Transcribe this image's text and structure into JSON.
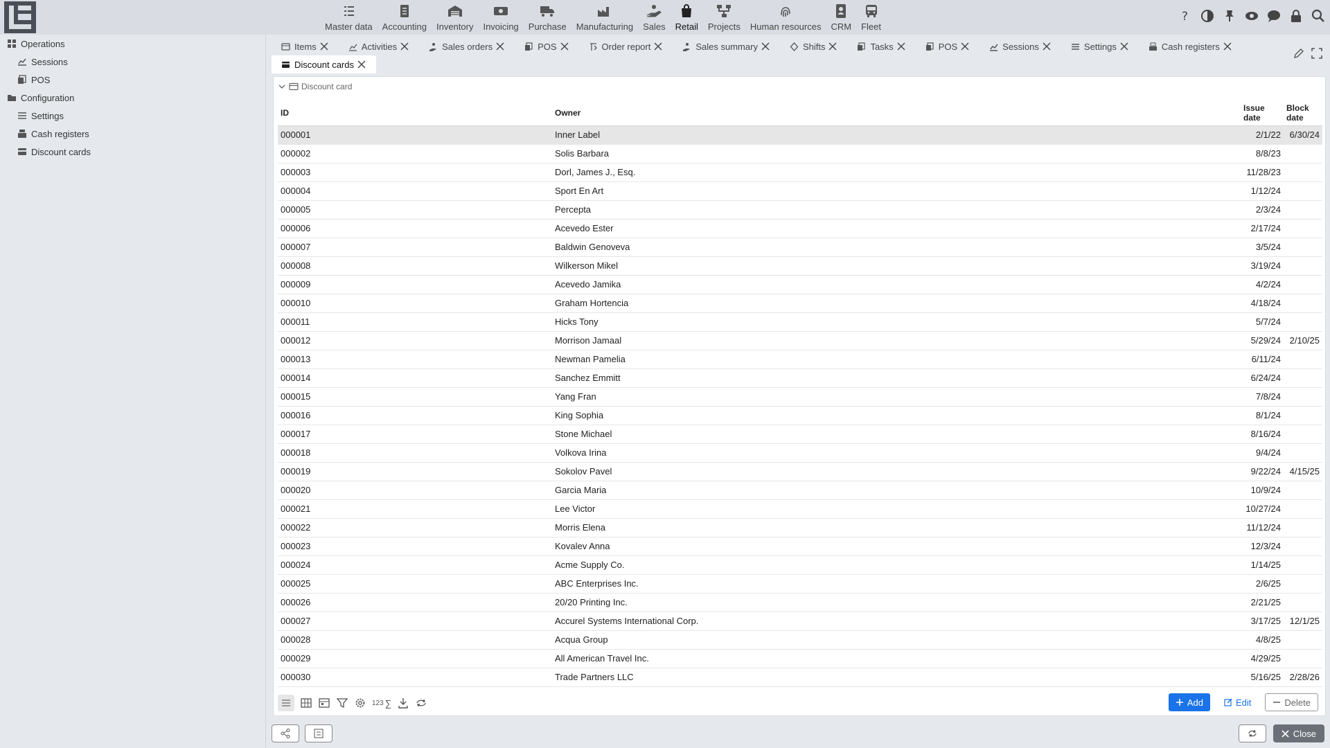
{
  "nav": [
    {
      "label": "Master data",
      "icon": "list-icon"
    },
    {
      "label": "Accounting",
      "icon": "document-icon"
    },
    {
      "label": "Inventory",
      "icon": "warehouse-icon"
    },
    {
      "label": "Invoicing",
      "icon": "cash-icon"
    },
    {
      "label": "Purchase",
      "icon": "truck-icon"
    },
    {
      "label": "Manufacturing",
      "icon": "factory-icon"
    },
    {
      "label": "Sales",
      "icon": "sales-hand-icon"
    },
    {
      "label": "Retail",
      "icon": "shopping-bag-icon",
      "active": true
    },
    {
      "label": "Projects",
      "icon": "project-tree-icon"
    },
    {
      "label": "Human resources",
      "icon": "fingerprint-icon"
    },
    {
      "label": "CRM",
      "icon": "contact-card-icon"
    },
    {
      "label": "Fleet",
      "icon": "bus-icon"
    }
  ],
  "top_icons": [
    "help-icon",
    "contrast-icon",
    "pin-icon",
    "eye-icon",
    "chat-icon",
    "lock-icon",
    "search-icon"
  ],
  "sidebar": {
    "groups": [
      {
        "label": "Operations",
        "items": [
          {
            "label": "Sessions"
          },
          {
            "label": "POS"
          }
        ]
      },
      {
        "label": "Configuration",
        "items": [
          {
            "label": "Settings"
          },
          {
            "label": "Cash registers"
          },
          {
            "label": "Discount cards"
          }
        ]
      }
    ]
  },
  "tabs": [
    {
      "label": "Items"
    },
    {
      "label": "Activities"
    },
    {
      "label": "Sales orders"
    },
    {
      "label": "POS"
    },
    {
      "label": "Order report"
    },
    {
      "label": "Sales summary"
    },
    {
      "label": "Shifts"
    },
    {
      "label": "Tasks"
    },
    {
      "label": "POS"
    },
    {
      "label": "Sessions"
    },
    {
      "label": "Settings"
    },
    {
      "label": "Cash registers"
    },
    {
      "label": "Discount cards",
      "active": true
    }
  ],
  "panel": {
    "title": "Discount card",
    "columns": {
      "id": "ID",
      "owner": "Owner",
      "issue_line1": "Issue",
      "issue_line2": "date",
      "block_line1": "Block",
      "block_line2": "date"
    },
    "rows": [
      {
        "id": "000001",
        "owner": "Inner Label",
        "issue": "2/1/22",
        "block": "6/30/24"
      },
      {
        "id": "000002",
        "owner": "Solis Barbara",
        "issue": "8/8/23",
        "block": ""
      },
      {
        "id": "000003",
        "owner": "Dorl, James J., Esq.",
        "issue": "11/28/23",
        "block": ""
      },
      {
        "id": "000004",
        "owner": "Sport En Art",
        "issue": "1/12/24",
        "block": ""
      },
      {
        "id": "000005",
        "owner": "Percepta",
        "issue": "2/3/24",
        "block": ""
      },
      {
        "id": "000006",
        "owner": "Acevedo Ester",
        "issue": "2/17/24",
        "block": ""
      },
      {
        "id": "000007",
        "owner": "Baldwin Genoveva",
        "issue": "3/5/24",
        "block": ""
      },
      {
        "id": "000008",
        "owner": "Wilkerson Mikel",
        "issue": "3/19/24",
        "block": ""
      },
      {
        "id": "000009",
        "owner": "Acevedo Jamika",
        "issue": "4/2/24",
        "block": ""
      },
      {
        "id": "000010",
        "owner": "Graham Hortencia",
        "issue": "4/18/24",
        "block": ""
      },
      {
        "id": "000011",
        "owner": "Hicks Tony",
        "issue": "5/7/24",
        "block": ""
      },
      {
        "id": "000012",
        "owner": "Morrison Jamaal",
        "issue": "5/29/24",
        "block": "2/10/25"
      },
      {
        "id": "000013",
        "owner": "Newman Pamelia",
        "issue": "6/11/24",
        "block": ""
      },
      {
        "id": "000014",
        "owner": "Sanchez Emmitt",
        "issue": "6/24/24",
        "block": ""
      },
      {
        "id": "000015",
        "owner": "Yang Fran",
        "issue": "7/8/24",
        "block": ""
      },
      {
        "id": "000016",
        "owner": "King Sophia",
        "issue": "8/1/24",
        "block": ""
      },
      {
        "id": "000017",
        "owner": "Stone Michael",
        "issue": "8/16/24",
        "block": ""
      },
      {
        "id": "000018",
        "owner": "Volkova Irina",
        "issue": "9/4/24",
        "block": ""
      },
      {
        "id": "000019",
        "owner": "Sokolov Pavel",
        "issue": "9/22/24",
        "block": "4/15/25"
      },
      {
        "id": "000020",
        "owner": "Garcia Maria",
        "issue": "10/9/24",
        "block": ""
      },
      {
        "id": "000021",
        "owner": "Lee Victor",
        "issue": "10/27/24",
        "block": ""
      },
      {
        "id": "000022",
        "owner": "Morris Elena",
        "issue": "11/12/24",
        "block": ""
      },
      {
        "id": "000023",
        "owner": "Kovalev Anna",
        "issue": "12/3/24",
        "block": ""
      },
      {
        "id": "000024",
        "owner": "Acme Supply Co.",
        "issue": "1/14/25",
        "block": ""
      },
      {
        "id": "000025",
        "owner": "ABC Enterprises Inc.",
        "issue": "2/6/25",
        "block": ""
      },
      {
        "id": "000026",
        "owner": "20/20 Printing Inc.",
        "issue": "2/21/25",
        "block": ""
      },
      {
        "id": "000027",
        "owner": "Accurel Systems International Corp.",
        "issue": "3/17/25",
        "block": "12/1/25"
      },
      {
        "id": "000028",
        "owner": "Acqua Group",
        "issue": "4/8/25",
        "block": ""
      },
      {
        "id": "000029",
        "owner": "All American Travel Inc.",
        "issue": "4/29/25",
        "block": ""
      },
      {
        "id": "000030",
        "owner": "Trade Partners LLC",
        "issue": "5/16/25",
        "block": "2/28/26"
      }
    ]
  },
  "toolbar": {
    "count_label": "123",
    "sum_label": "∑"
  },
  "actions": {
    "add": "Add",
    "edit": "Edit",
    "delete": "Delete"
  },
  "footer": {
    "close": "Close"
  },
  "colors": {
    "primary": "#1a73e8",
    "selected_row": "#e6e6e6"
  }
}
